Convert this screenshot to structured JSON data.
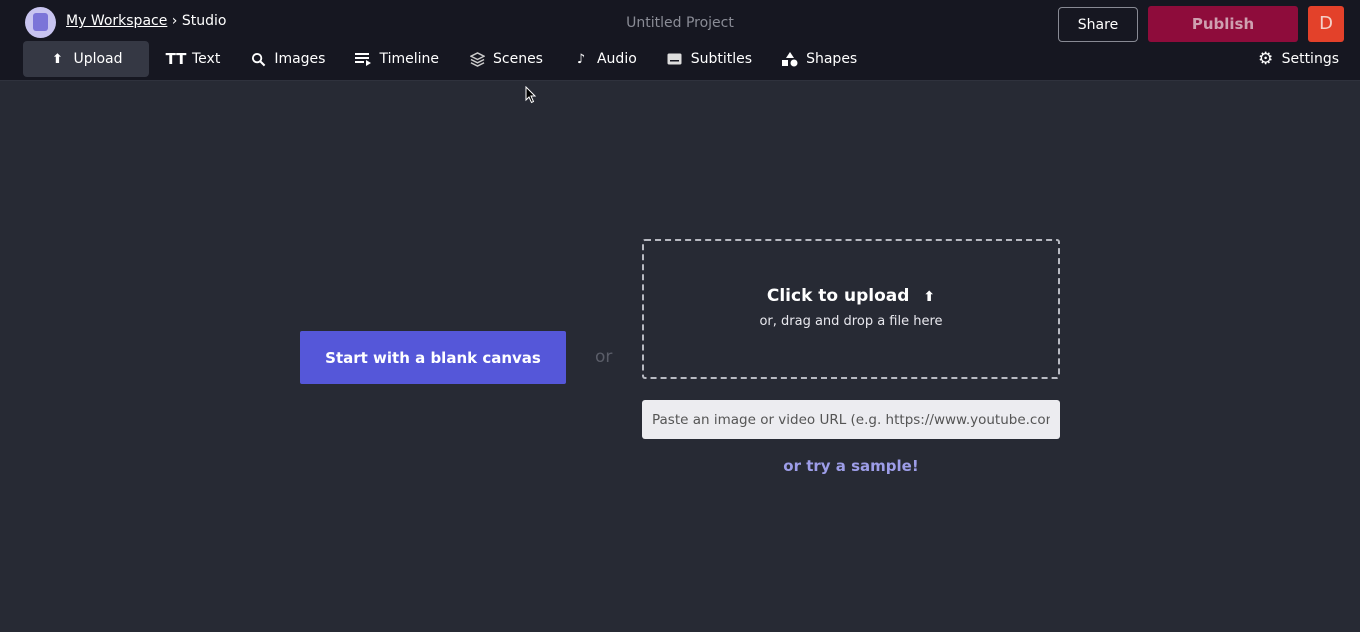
{
  "header": {
    "breadcrumb": {
      "workspace": "My Workspace",
      "separator": "›",
      "current": "Studio"
    },
    "project_title": "Untitled Project",
    "share_label": "Share",
    "publish_label": "Publish",
    "avatar_initial": "D"
  },
  "tabs": [
    {
      "label": "Upload",
      "icon": "upload-icon",
      "active": true
    },
    {
      "label": "Text",
      "icon": "text-icon"
    },
    {
      "label": "Images",
      "icon": "search-icon"
    },
    {
      "label": "Timeline",
      "icon": "timeline-icon"
    },
    {
      "label": "Scenes",
      "icon": "layers-icon"
    },
    {
      "label": "Audio",
      "icon": "music-note-icon"
    },
    {
      "label": "Subtitles",
      "icon": "subtitles-icon"
    },
    {
      "label": "Shapes",
      "icon": "shapes-icon"
    }
  ],
  "settings_label": "Settings",
  "main": {
    "blank_canvas_label": "Start with a blank canvas",
    "or_label": "or",
    "upload_title": "Click to upload",
    "upload_subtitle": "or, drag and drop a file here",
    "url_placeholder": "Paste an image or video URL (e.g. https://www.youtube.com/watch?v=...)",
    "sample_label": "or try a sample!"
  },
  "colors": {
    "accent": "#5557d9",
    "publish": "#8e0c3b",
    "avatar": "#e3412a",
    "link": "#9d9de8"
  }
}
